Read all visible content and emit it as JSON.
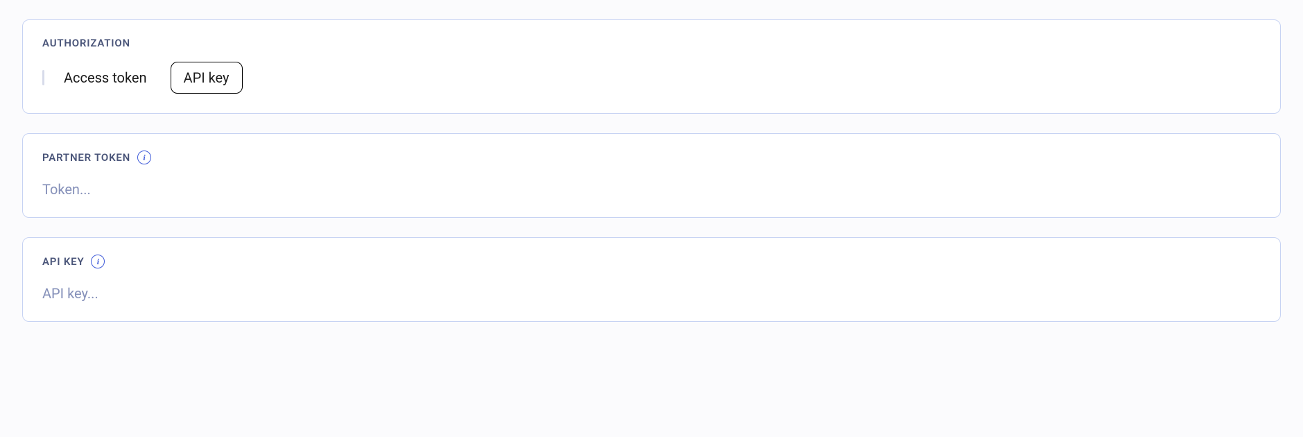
{
  "authorization": {
    "section_label": "AUTHORIZATION",
    "tabs": {
      "access_token": "Access token",
      "api_key": "API key"
    }
  },
  "partner_token": {
    "section_label": "PARTNER TOKEN",
    "placeholder": "Token..."
  },
  "api_key": {
    "section_label": "API KEY",
    "placeholder": "API key..."
  },
  "info_glyph": "i"
}
